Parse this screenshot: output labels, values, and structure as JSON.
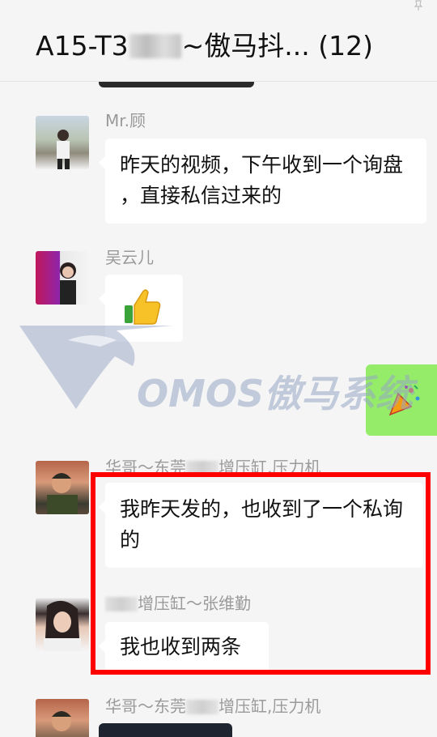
{
  "header": {
    "title_prefix": "A15-T3",
    "title_suffix": "~傲马抖... (12)"
  },
  "messages": [
    {
      "sender": "Mr.顾",
      "text": "昨天的视频，下午收到一个询盘 ，直接私信过来的"
    },
    {
      "sender": "吴云儿",
      "emoji": "thumbs-up"
    },
    {
      "sender_prefix": "华哥～东莞",
      "sender_suffix": "增压缸,压力机",
      "text": "我昨天发的，也收到了一个私询的"
    },
    {
      "sender_prefix": "",
      "sender_suffix": "增压缸～张维勤",
      "text": "我也收到两条"
    },
    {
      "sender_prefix": "华哥～东莞",
      "sender_suffix": "增压缸,压力机"
    }
  ],
  "watermark": {
    "text": "OMOS傲马系统"
  },
  "colors": {
    "background": "#f5f5f5",
    "bubble": "#ffffff",
    "own_bubble": "#95ec69",
    "highlight": "#ff0000",
    "sender_name": "#9a9a9a"
  },
  "icons": [
    "pin-icon",
    "thumbs-up-icon",
    "party-popper-icon",
    "horse-logo-icon"
  ]
}
